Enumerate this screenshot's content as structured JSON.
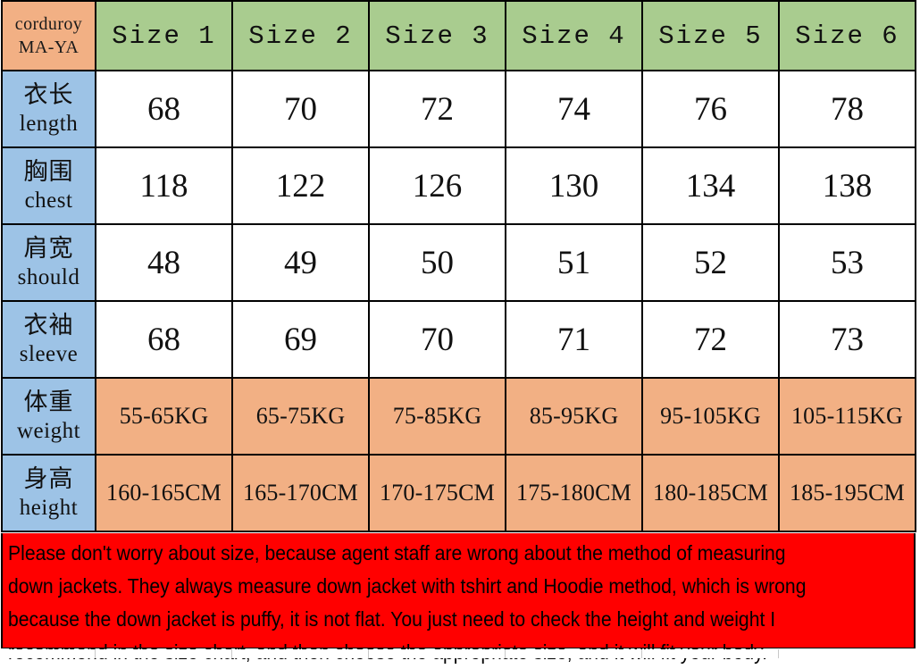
{
  "brand": {
    "line1": "corduroy",
    "line2": "MA-YA"
  },
  "colors": {
    "corner_bg": "#f2b084",
    "size_header_bg": "#a9cc8f",
    "row_label_bg": "#9dc3e6",
    "measure_bg": "#ffffff",
    "range_bg": "#f2b084",
    "warning_bg": "#ff0000",
    "warning_text": "#000000",
    "border": "#000000"
  },
  "size_headers": [
    "Size 1",
    "Size 2",
    "Size 3",
    "Size 4",
    "Size 5",
    "Size 6"
  ],
  "rows": [
    {
      "cn": "衣长",
      "en": "length",
      "style": "measure",
      "values": [
        "68",
        "70",
        "72",
        "74",
        "76",
        "78"
      ]
    },
    {
      "cn": "胸围",
      "en": "chest",
      "style": "measure",
      "values": [
        "118",
        "122",
        "126",
        "130",
        "134",
        "138"
      ]
    },
    {
      "cn": "肩宽",
      "en": "should",
      "style": "measure",
      "values": [
        "48",
        "49",
        "50",
        "51",
        "52",
        "53"
      ]
    },
    {
      "cn": "衣袖",
      "en": "sleeve",
      "style": "measure",
      "values": [
        "68",
        "69",
        "70",
        "71",
        "72",
        "73"
      ]
    },
    {
      "cn": "体重",
      "en": "weight",
      "style": "range",
      "values": [
        "55-65KG",
        "65-75KG",
        "75-85KG",
        "85-95KG",
        "95-105KG",
        "105-115KG"
      ]
    },
    {
      "cn": "身高",
      "en": "height",
      "style": "range",
      "values": [
        "160-165CM",
        "165-170CM",
        "170-175CM",
        "175-180CM",
        "180-185CM",
        "185-195CM"
      ]
    }
  ],
  "warning": {
    "line1": "Please don't worry about size, because agent staff are wrong about the method of measuring",
    "line2": "down jackets. They always measure down jacket with tshirt and Hoodie method, which is wrong",
    "line3": "because the down jacket is puffy, it is not flat. You just need to check the height and weight I",
    "line4": "recommend in the size chart, and then choose the appropriate size, and it will fit your body."
  }
}
